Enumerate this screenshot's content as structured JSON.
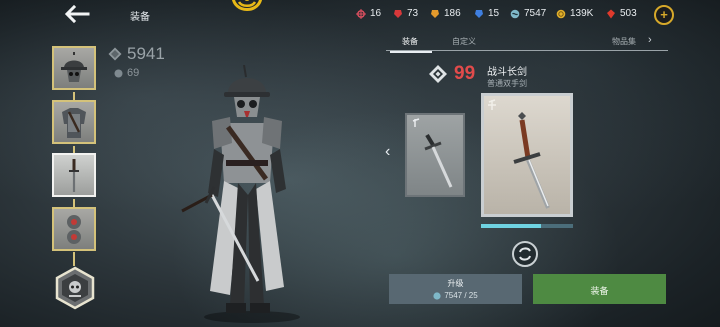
{
  "header": {
    "title": "装备",
    "resources": [
      {
        "name": "crosshair",
        "value": "16",
        "color": "#e05060"
      },
      {
        "name": "red-gem",
        "value": "73",
        "color": "#d8383a"
      },
      {
        "name": "orange-gem",
        "value": "186",
        "color": "#e49a2c"
      },
      {
        "name": "blue-gem",
        "value": "15",
        "color": "#3f7fe0"
      },
      {
        "name": "orb",
        "value": "7547",
        "color": "#7fb8c8"
      },
      {
        "name": "coin",
        "value": "139K",
        "color": "#e2b02c"
      },
      {
        "name": "ruby",
        "value": "503",
        "color": "#e03a2c"
      }
    ]
  },
  "stats": {
    "power": "5941",
    "sub_power": "69"
  },
  "tabs": {
    "equip": "装备",
    "custom": "自定义",
    "collection": "物品集"
  },
  "item": {
    "rating": "99",
    "name": "战斗长剑",
    "type": "普通双手剑",
    "progress": 0.65
  },
  "actions": {
    "upgrade_label": "升级",
    "upgrade_cost": "7547 / 25",
    "equip_label": "装备"
  },
  "colors": {
    "accent_gold": "#d4c27a",
    "rating_red": "#e24b4b",
    "equip_green": "#4e8a42",
    "upgrade_slate": "#586872"
  }
}
